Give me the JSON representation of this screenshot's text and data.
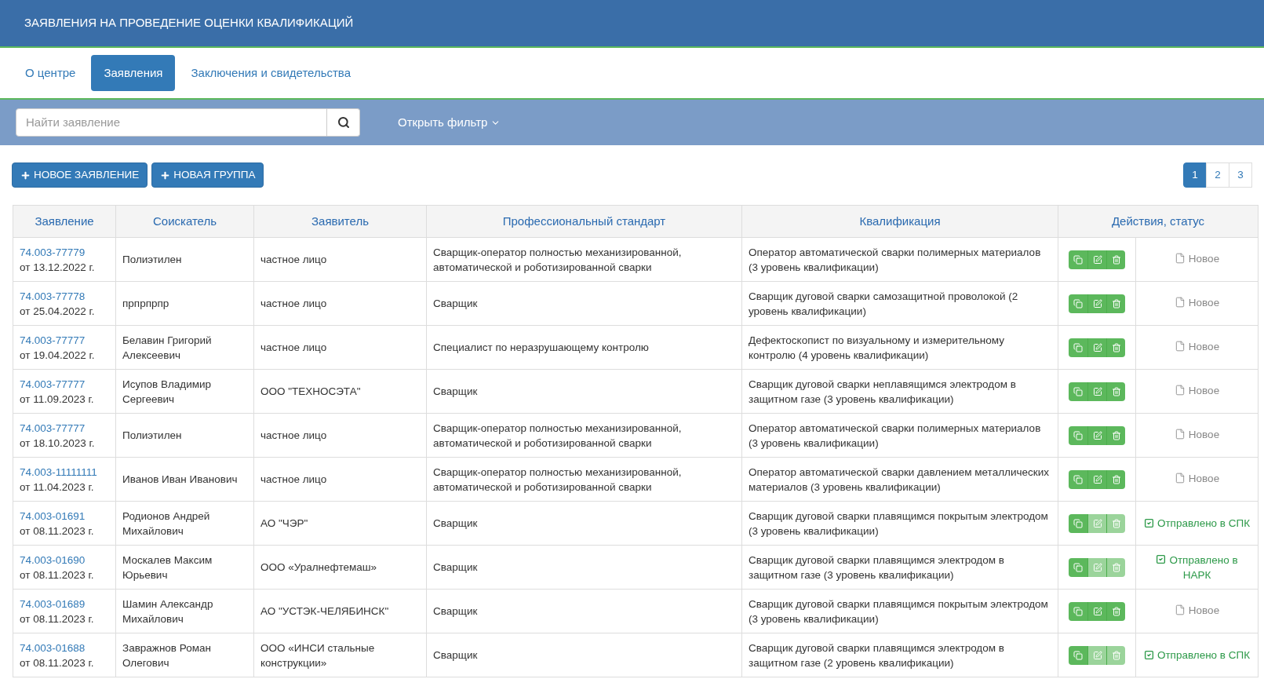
{
  "header": {
    "title": "ЗАЯВЛЕНИЯ НА ПРОВЕДЕНИЕ ОЦЕНКИ КВАЛИФИКАЦИЙ"
  },
  "tabs": [
    {
      "label": "О центре",
      "selected": false
    },
    {
      "label": "Заявления",
      "selected": true
    },
    {
      "label": "Заключения и свидетельства",
      "selected": false
    }
  ],
  "search": {
    "placeholder": "Найти заявление"
  },
  "filter_toggle": "Открыть фильтр",
  "actions": [
    "НОВОЕ ЗАЯВЛЕНИЕ",
    "НОВАЯ ГРУППА"
  ],
  "pagination": [
    {
      "label": "1",
      "selected": true
    },
    {
      "label": "2",
      "selected": false
    },
    {
      "label": "3",
      "selected": false
    }
  ],
  "table": {
    "columns": [
      "Заявление",
      "Соискатель",
      "Заявитель",
      "Профессиональный стандарт",
      "Квалификация",
      "Действия, статус"
    ],
    "rows": [
      {
        "number": "74.003-77779",
        "date": "от 13.12.2022 г.",
        "applicant": "Полиэтилен",
        "requester": "частное лицо",
        "standard": "Сварщик-оператор полностью механизированной, автоматической и роботизированной сварки",
        "qualification": "Оператор автоматической сварки полимерных материалов (3 уровень квалификации)",
        "locked": false,
        "status": {
          "kind": "new",
          "label": "Новое"
        }
      },
      {
        "number": "74.003-77778",
        "date": "от 25.04.2022 г.",
        "applicant": "прпрпрпр",
        "requester": "частное лицо",
        "standard": "Сварщик",
        "qualification": "Сварщик дуговой сварки самозащитной проволокой (2 уровень квалификации)",
        "locked": false,
        "status": {
          "kind": "new",
          "label": "Новое"
        }
      },
      {
        "number": "74.003-77777",
        "date": "от 19.04.2022 г.",
        "applicant": "Белавин Григорий Алексеевич",
        "requester": "частное лицо",
        "standard": "Специалист по неразрушающему контролю",
        "qualification": "Дефектоскопист по визуальному и измерительному контролю (4 уровень квалификации)",
        "locked": false,
        "status": {
          "kind": "new",
          "label": "Новое"
        }
      },
      {
        "number": "74.003-77777",
        "date": "от 11.09.2023 г.",
        "applicant": "Исупов Владимир Сергеевич",
        "requester": "ООО \"ТЕХНОСЭТА\"",
        "standard": "Сварщик",
        "qualification": "Сварщик дуговой сварки неплавящимся электродом в защитном газе (3 уровень квалификации)",
        "locked": false,
        "status": {
          "kind": "new",
          "label": "Новое"
        }
      },
      {
        "number": "74.003-77777",
        "date": "от 18.10.2023 г.",
        "applicant": "Полиэтилен",
        "requester": "частное лицо",
        "standard": "Сварщик-оператор полностью механизированной, автоматической и роботизированной сварки",
        "qualification": "Оператор автоматической сварки полимерных материалов (3 уровень квалификации)",
        "locked": false,
        "status": {
          "kind": "new",
          "label": "Новое"
        }
      },
      {
        "number": "74.003-11111111",
        "date": "от 11.04.2023 г.",
        "applicant": "Иванов Иван Иванович",
        "requester": "частное лицо",
        "standard": "Сварщик-оператор полностью механизированной, автоматической и роботизированной сварки",
        "qualification": "Оператор автоматической сварки давлением металлических материалов (3 уровень квалификации)",
        "locked": false,
        "status": {
          "kind": "new",
          "label": "Новое"
        }
      },
      {
        "number": "74.003-01691",
        "date": "от 08.11.2023 г.",
        "applicant": "Родионов Андрей Михайлович",
        "requester": "АО \"ЧЭР\"",
        "standard": "Сварщик",
        "qualification": "Сварщик дуговой сварки плавящимся покрытым электродом (3 уровень квалификации)",
        "locked": true,
        "status": {
          "kind": "sent",
          "label": "Отправлено в СПК"
        }
      },
      {
        "number": "74.003-01690",
        "date": "от 08.11.2023 г.",
        "applicant": "Москалев Максим Юрьевич",
        "requester": "ООО «Уралнефтемаш»",
        "standard": "Сварщик",
        "qualification": "Сварщик дуговой сварки плавящимся электродом в защитном газе (3 уровень квалификации)",
        "locked": true,
        "status": {
          "kind": "sent",
          "label": "Отправлено в НАРК"
        }
      },
      {
        "number": "74.003-01689",
        "date": "от 08.11.2023 г.",
        "applicant": "Шамин Александр Михайлович",
        "requester": "АО \"УСТЭК-ЧЕЛЯБИНСК\"",
        "standard": "Сварщик",
        "qualification": "Сварщик дуговой сварки плавящимся покрытым электродом (3 уровень квалификации)",
        "locked": false,
        "status": {
          "kind": "new",
          "label": "Новое"
        }
      },
      {
        "number": "74.003-01688",
        "date": "от 08.11.2023 г.",
        "applicant": "Завражнов Роман Олегович",
        "requester": "ООО «ИНСИ стальные конструкции»",
        "standard": "Сварщик",
        "qualification": "Сварщик дуговой сварки плавящимся электродом в защитном газе (2 уровень квалификации)",
        "locked": true,
        "status": {
          "kind": "sent",
          "label": "Отправлено в СПК"
        }
      }
    ]
  }
}
